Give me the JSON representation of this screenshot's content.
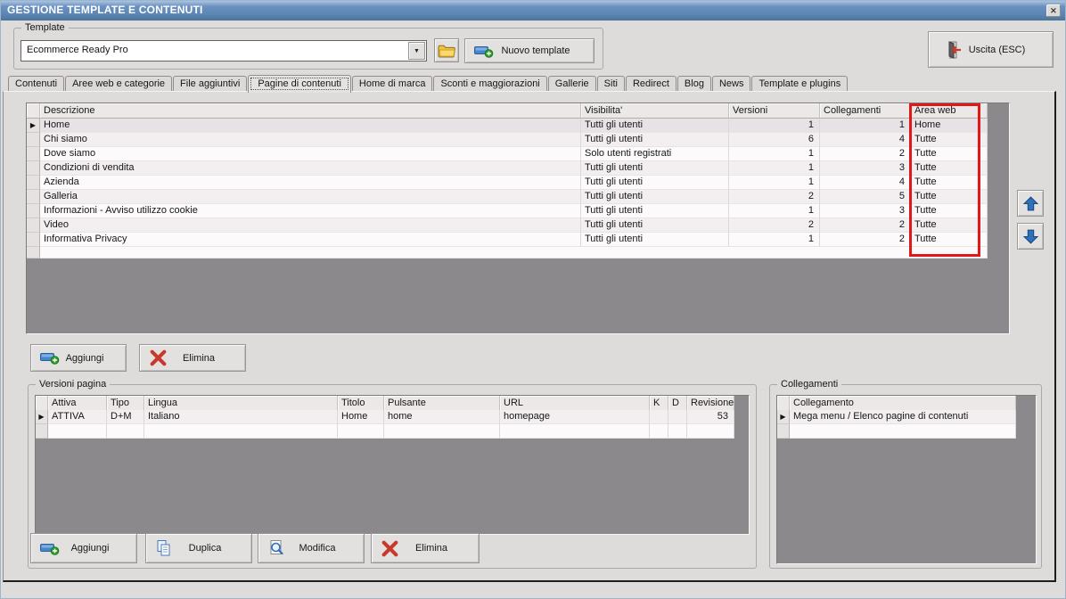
{
  "window": {
    "title": "GESTIONE TEMPLATE E CONTENUTI"
  },
  "icons": {
    "close": "✕",
    "dropdown": "▼",
    "current_row_marker": "▶"
  },
  "template_box": {
    "label": "Template",
    "combo_value": "Ecommerce Ready Pro",
    "new_template_label": "Nuovo template"
  },
  "exit_button_label": "Uscita (ESC)",
  "tabs": [
    {
      "label": "Contenuti"
    },
    {
      "label": "Aree web e categorie"
    },
    {
      "label": "File aggiuntivi"
    },
    {
      "label": "Pagine di contenuti",
      "active": true
    },
    {
      "label": "Home di marca"
    },
    {
      "label": "Sconti e maggiorazioni"
    },
    {
      "label": "Gallerie"
    },
    {
      "label": "Siti"
    },
    {
      "label": "Redirect"
    },
    {
      "label": "Blog"
    },
    {
      "label": "News"
    },
    {
      "label": "Template e plugins"
    }
  ],
  "pages_grid": {
    "columns": [
      "Descrizione",
      "Visibilita'",
      "Versioni",
      "Collegamenti",
      "Area web"
    ],
    "rows": [
      [
        "Home",
        "Tutti gli utenti",
        "1",
        "1",
        "Home"
      ],
      [
        "Chi siamo",
        "Tutti gli utenti",
        "6",
        "4",
        "Tutte"
      ],
      [
        "Dove siamo",
        "Solo utenti registrati",
        "1",
        "2",
        "Tutte"
      ],
      [
        "Condizioni di vendita",
        "Tutti gli utenti",
        "1",
        "3",
        "Tutte"
      ],
      [
        "Azienda",
        "Tutti gli utenti",
        "1",
        "4",
        "Tutte"
      ],
      [
        "Galleria",
        "Tutti gli utenti",
        "2",
        "5",
        "Tutte"
      ],
      [
        "Informazioni - Avviso utilizzo cookie",
        "Tutti gli utenti",
        "1",
        "3",
        "Tutte"
      ],
      [
        "Video",
        "Tutti gli utenti",
        "2",
        "2",
        "Tutte"
      ],
      [
        "Informativa Privacy",
        "Tutti gli utenti",
        "1",
        "2",
        "Tutte"
      ]
    ]
  },
  "highlight": {
    "target": "Area web",
    "color": "#e21717"
  },
  "main_actions": {
    "add": "Aggiungi",
    "delete": "Elimina"
  },
  "versions_box": {
    "label": "Versioni pagina",
    "columns": [
      "Attiva",
      "Tipo",
      "Lingua",
      "Titolo",
      "Pulsante",
      "URL",
      "K",
      "D",
      "Revisione"
    ],
    "rows": [
      [
        "ATTIVA",
        "D+M",
        "Italiano",
        "Home",
        "home",
        "homepage",
        "",
        "",
        "53"
      ]
    ],
    "actions": {
      "add": "Aggiungi",
      "duplicate": "Duplica",
      "modify": "Modifica",
      "delete": "Elimina"
    }
  },
  "links_box": {
    "label": "Collegamenti",
    "columns": [
      "Collegamento"
    ],
    "rows": [
      [
        "Mega menu / Elenco pagine di contenuti"
      ]
    ]
  },
  "colors": {
    "titlebar_blue": "#5b85b4",
    "accent_red": "#c8392b",
    "arrow_blue": "#2e6fba",
    "grid_gray": "#8b898b",
    "highlight_red": "#e21717"
  }
}
